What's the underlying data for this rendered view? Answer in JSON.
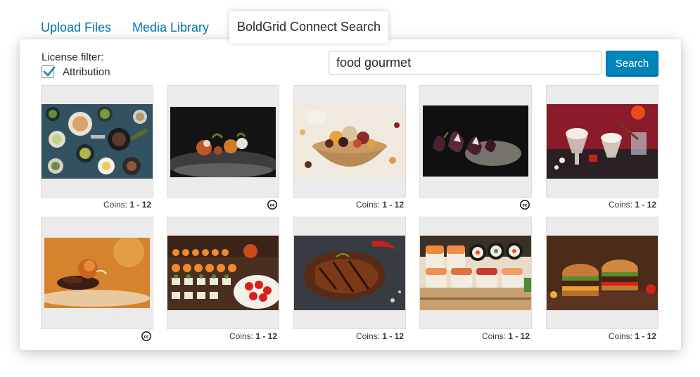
{
  "tabs": [
    {
      "label": "Upload Files",
      "active": false
    },
    {
      "label": "Media Library",
      "active": false
    },
    {
      "label": "BoldGrid Connect Search",
      "active": true
    }
  ],
  "filter": {
    "label": "License filter:",
    "checkbox_label": "Attribution",
    "checked": true
  },
  "search": {
    "value": "food gourmet",
    "button_label": "Search"
  },
  "colors": {
    "accent": "#0085ba",
    "tab_link": "#0073aa"
  },
  "results": [
    {
      "subject": "table of dishes top view",
      "price_label": "Coins:",
      "price": "1 - 12",
      "license": "coins"
    },
    {
      "subject": "gourmet plated appetizer",
      "license": "cc",
      "icon": "cc-icon"
    },
    {
      "subject": "dried fruit bowl",
      "price_label": "Coins:",
      "price": "1 - 12",
      "license": "coins"
    },
    {
      "subject": "stuffed figs on plate",
      "license": "cc",
      "icon": "cc-icon"
    },
    {
      "subject": "dessert glasses on red background",
      "price_label": "Coins:",
      "price": "1 - 12",
      "license": "coins"
    },
    {
      "subject": "fine dining scallop dish",
      "license": "cc",
      "icon": "cc-icon"
    },
    {
      "subject": "canape catering trays",
      "price_label": "Coins:",
      "price": "1 - 12",
      "license": "coins"
    },
    {
      "subject": "grilled steak with chili",
      "price_label": "Coins:",
      "price": "1 - 12",
      "license": "coins"
    },
    {
      "subject": "sushi rolls",
      "price_label": "Coins:",
      "price": "1 - 12",
      "license": "coins"
    },
    {
      "subject": "gourmet burgers",
      "price_label": "Coins:",
      "price": "1 - 12",
      "license": "coins"
    }
  ]
}
